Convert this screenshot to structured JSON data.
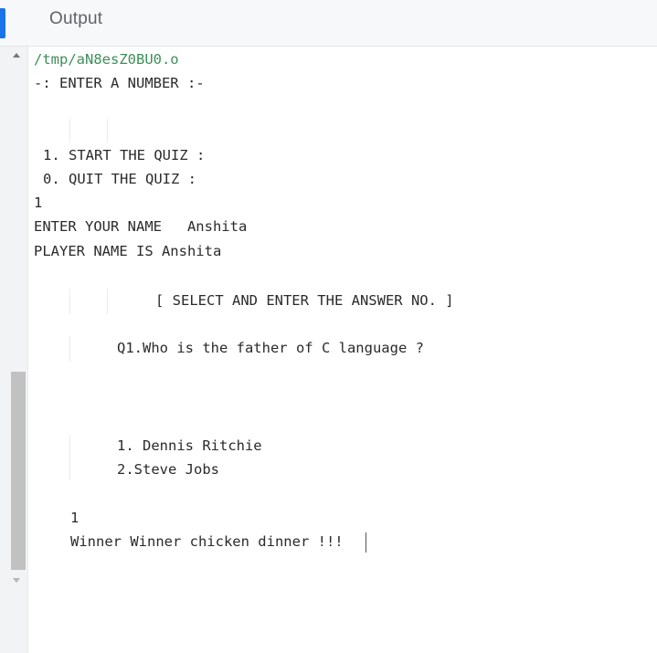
{
  "header": {
    "tab_label": "Output",
    "accent_color": "#1a73e8"
  },
  "console": {
    "lines": {
      "path": "/tmp/aN8esZ0BU0.o",
      "enter_number": "-: ENTER A NUMBER :-",
      "start_quiz": "1. START THE QUIZ :",
      "quit_quiz": "0. QUIT THE QUIZ :",
      "input_choice": "1",
      "enter_name": "ENTER YOUR NAME   Anshita",
      "player_name": "PLAYER NAME IS Anshita",
      "select_prompt": "[ SELECT AND ENTER THE ANSWER NO. ]",
      "question": "Q1.Who is the father of C language ?",
      "option_1": "1. Dennis Ritchie",
      "option_2": "2.Steve Jobs",
      "answer_input": "1",
      "result": "Winner Winner chicken dinner !!!"
    },
    "path_color": "#3c8f59",
    "text_color": "#2b2b2b"
  },
  "icons": {
    "scroll_up": "triangle-up-icon",
    "scroll_down": "triangle-down-icon"
  }
}
